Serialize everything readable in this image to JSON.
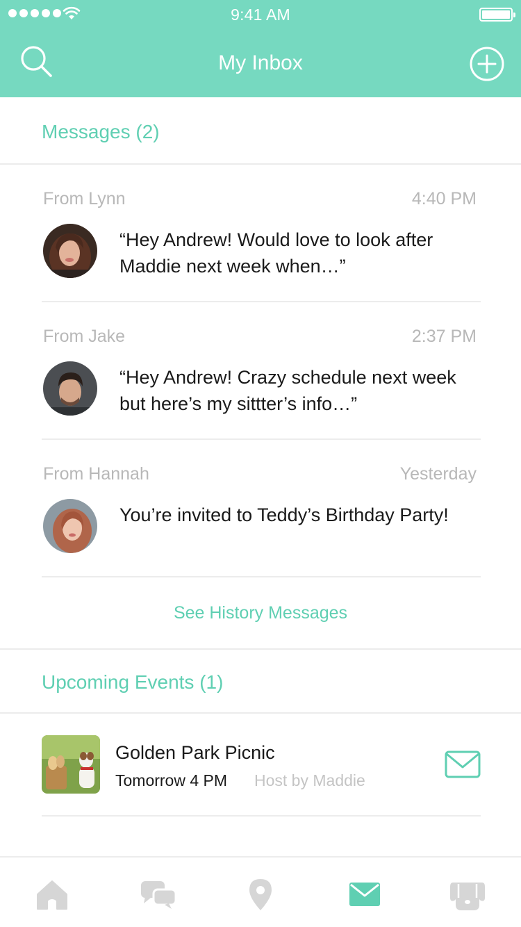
{
  "status_bar": {
    "time": "9:41 AM"
  },
  "nav": {
    "title": "My Inbox",
    "left_icon": "search-icon",
    "right_icon": "add-circle-icon"
  },
  "messages_section": {
    "title": "Messages (2)"
  },
  "messages": [
    {
      "from": "From Lynn",
      "time": "4:40 PM",
      "text": "“Hey Andrew! Would love to look after Maddie next week when…”"
    },
    {
      "from": "From Jake",
      "time": "2:37 PM",
      "text": "“Hey Andrew! Crazy schedule next week but here’s my sittter’s info…”"
    },
    {
      "from": "From Hannah",
      "time": "Yesterday",
      "text": "You’re invited to Teddy’s Birthday Party!"
    }
  ],
  "see_history": "See History Messages",
  "events_section": {
    "title": "Upcoming Events (1)"
  },
  "events": [
    {
      "title": "Golden Park Picnic",
      "time": "Tomorrow 4 PM",
      "host": "Host by Maddie"
    }
  ],
  "tabbar": {
    "items": [
      "home-icon",
      "chat-icon",
      "location-pin-icon",
      "mail-icon",
      "dog-icon"
    ],
    "active": "mail-icon"
  },
  "colors": {
    "accent": "#76d9c0",
    "accent_text": "#5fcfb2",
    "muted": "#b8b8b8",
    "inactive_icon": "#d6d6d6"
  }
}
